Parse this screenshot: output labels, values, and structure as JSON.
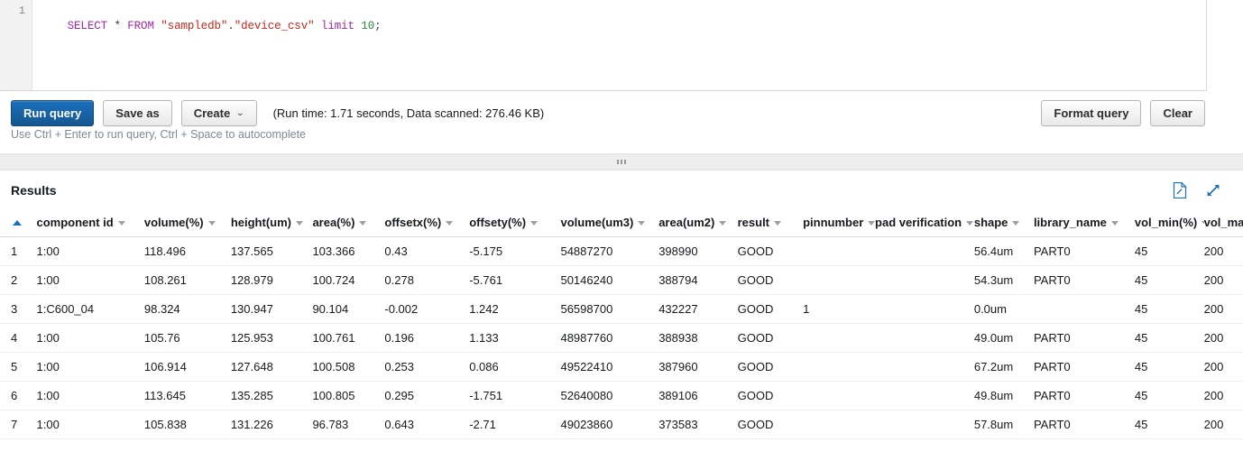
{
  "editor": {
    "line_number": "1",
    "sql_tokens": [
      {
        "t": "SELECT",
        "c": "kw"
      },
      {
        "t": " ",
        "c": "pun"
      },
      {
        "t": "*",
        "c": "pun"
      },
      {
        "t": " ",
        "c": "pun"
      },
      {
        "t": "FROM",
        "c": "kw"
      },
      {
        "t": " ",
        "c": "pun"
      },
      {
        "t": "\"sampledb\"",
        "c": "str"
      },
      {
        "t": ".",
        "c": "pun"
      },
      {
        "t": "\"device_csv\"",
        "c": "str"
      },
      {
        "t": " ",
        "c": "pun"
      },
      {
        "t": "limit",
        "c": "kw"
      },
      {
        "t": " ",
        "c": "pun"
      },
      {
        "t": "10",
        "c": "num"
      },
      {
        "t": ";",
        "c": "pun"
      }
    ],
    "sql_text": "SELECT * FROM \"sampledb\".\"device_csv\" limit 10;"
  },
  "toolbar": {
    "run_query_label": "Run query",
    "save_as_label": "Save as",
    "create_label": "Create",
    "create_caret": "⌄",
    "run_stats": "(Run time: 1.71 seconds, Data scanned: 276.46 KB)",
    "format_query_label": "Format query",
    "clear_label": "Clear",
    "hint": "Use Ctrl + Enter to run query, Ctrl + Space to autocomplete",
    "primary_color": "#15578f"
  },
  "results": {
    "title": "Results",
    "download_icon": "download-file-icon",
    "expand_icon": "expand-fullscreen-icon",
    "index_header": "",
    "columns": [
      "component id",
      "volume(%)",
      "height(um)",
      "area(%)",
      "offsetx(%)",
      "offsety(%)",
      "volume(um3)",
      "area(um2)",
      "result",
      "pinnumber",
      "pad verification",
      "shape",
      "library_name",
      "vol_min(%)",
      "vol_max("
    ],
    "rows": [
      {
        "idx": "1",
        "cells": [
          "1:00",
          "118.496",
          "137.565",
          "103.366",
          "0.43",
          "-5.175",
          "54887270",
          "398990",
          "GOOD",
          "",
          "",
          "56.4um",
          "PART0",
          "45",
          "200"
        ]
      },
      {
        "idx": "2",
        "cells": [
          "1:00",
          "108.261",
          "128.979",
          "100.724",
          "0.278",
          "-5.761",
          "50146240",
          "388794",
          "GOOD",
          "",
          "",
          "54.3um",
          "PART0",
          "45",
          "200"
        ]
      },
      {
        "idx": "3",
        "cells": [
          "1:C600_04",
          "98.324",
          "130.947",
          "90.104",
          "-0.002",
          "1.242",
          "56598700",
          "432227",
          "GOOD",
          "1",
          "",
          "0.0um",
          "",
          "45",
          "200"
        ]
      },
      {
        "idx": "4",
        "cells": [
          "1:00",
          "105.76",
          "125.953",
          "100.761",
          "0.196",
          "1.133",
          "48987760",
          "388938",
          "GOOD",
          "",
          "",
          "49.0um",
          "PART0",
          "45",
          "200"
        ]
      },
      {
        "idx": "5",
        "cells": [
          "1:00",
          "106.914",
          "127.648",
          "100.508",
          "0.253",
          "0.086",
          "49522410",
          "387960",
          "GOOD",
          "",
          "",
          "67.2um",
          "PART0",
          "45",
          "200"
        ]
      },
      {
        "idx": "6",
        "cells": [
          "1:00",
          "113.645",
          "135.285",
          "100.805",
          "0.295",
          "-1.751",
          "52640080",
          "389106",
          "GOOD",
          "",
          "",
          "49.8um",
          "PART0",
          "45",
          "200"
        ]
      },
      {
        "idx": "7",
        "cells": [
          "1:00",
          "105.838",
          "131.226",
          "96.783",
          "0.643",
          "-2.71",
          "49023860",
          "373583",
          "GOOD",
          "",
          "",
          "57.8um",
          "PART0",
          "45",
          "200"
        ]
      }
    ]
  }
}
